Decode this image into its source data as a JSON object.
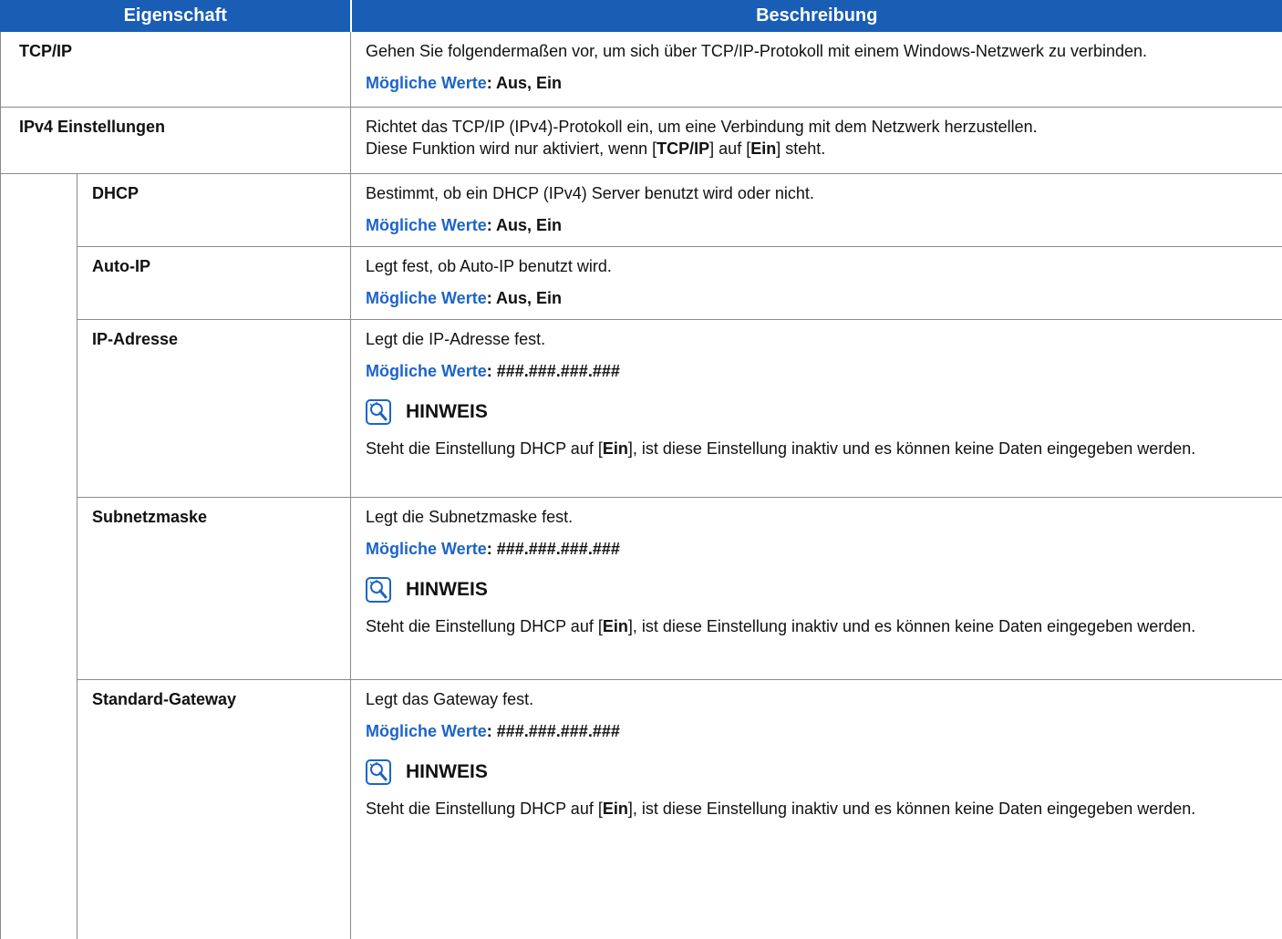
{
  "header": {
    "col_property": "Eigenschaft",
    "col_description": "Beschreibung"
  },
  "labels": {
    "possible_values": "Mögliche Werte",
    "note": "HINWEIS"
  },
  "icons": {
    "note": "hint-lightbulb-icon"
  },
  "colors": {
    "header_bg": "#1a5db5",
    "accent_text": "#1c64c8"
  },
  "rows": [
    {
      "name": "TCP/IP",
      "desc": "Gehen Sie folgendermaßen vor, um sich über TCP/IP-Protokoll mit einem Windows-Netzwerk zu verbinden.",
      "values": "Aus, Ein"
    },
    {
      "name": "IPv4 Einstellungen",
      "desc_line1": "Richtet das TCP/IP (IPv4)-Protokoll ein, um eine Verbindung mit dem Netzwerk herzustellen.",
      "desc_line2_pre": "Diese Funktion wird nur aktiviert, wenn [",
      "desc_line2_b1": "TCP/IP",
      "desc_line2_mid": "] auf [",
      "desc_line2_b2": "Ein",
      "desc_line2_post": "] steht."
    },
    {
      "name": "DHCP",
      "desc": "Bestimmt, ob ein DHCP (IPv4) Server benutzt wird oder nicht.",
      "values": "Aus, Ein"
    },
    {
      "name": "Auto-IP",
      "desc": "Legt fest, ob Auto-IP benutzt wird.",
      "values": "Aus, Ein"
    },
    {
      "name": "IP-Adresse",
      "desc": "Legt die IP-Adresse fest.",
      "values": "###.###.###.###",
      "note_pre": "Steht die Einstellung DHCP auf [",
      "note_bold": "Ein",
      "note_post": "], ist diese Einstellung inaktiv und es können keine Daten eingegeben werden."
    },
    {
      "name": "Subnetzmaske",
      "desc": "Legt die Subnetzmaske fest.",
      "values": "###.###.###.###",
      "note_pre": "Steht die Einstellung DHCP auf [",
      "note_bold": "Ein",
      "note_post": "], ist diese Einstellung inaktiv und es können keine Daten eingegeben werden."
    },
    {
      "name": "Standard-Gateway",
      "desc": "Legt das Gateway fest.",
      "values": "###.###.###.###",
      "note_pre": "Steht die Einstellung DHCP auf [",
      "note_bold": "Ein",
      "note_post": "], ist diese Einstellung inaktiv und es können keine Daten eingegeben werden."
    }
  ]
}
